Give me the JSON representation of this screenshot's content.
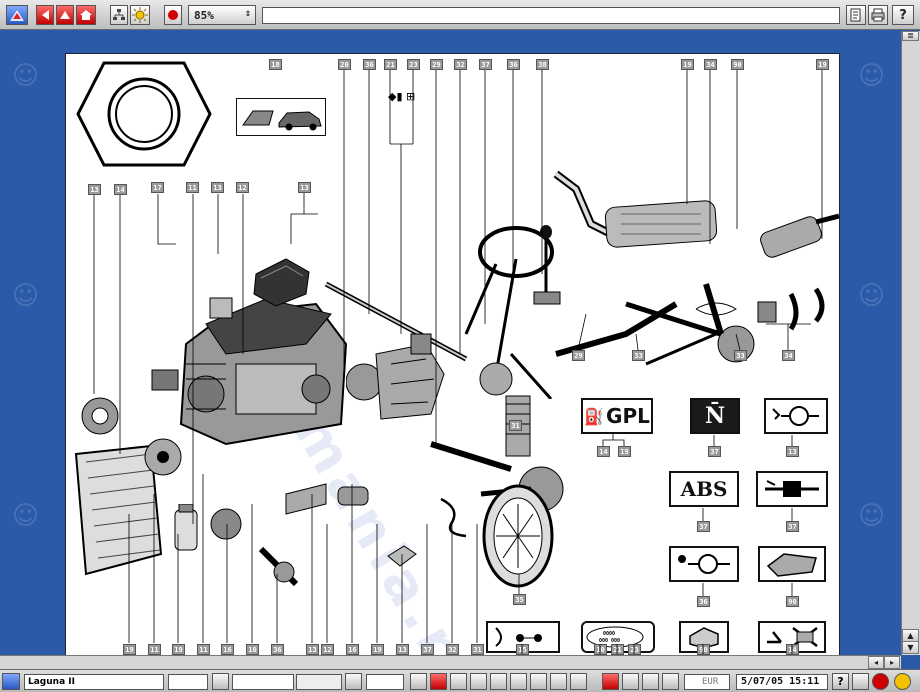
{
  "toolbar": {
    "zoom_value": "85%",
    "address_value": ""
  },
  "diagram": {
    "watermark_text": "ecmania.ru",
    "callouts_top": [
      "18",
      "20",
      "36",
      "21",
      "23",
      "29",
      "32",
      "37",
      "36",
      "38",
      "19",
      "34",
      "90",
      "19"
    ],
    "callouts_left": [
      "13",
      "14",
      "17",
      "11",
      "13",
      "12",
      "13"
    ],
    "callouts_bottom": [
      "19",
      "11",
      "19",
      "11",
      "16",
      "10",
      "36",
      "13",
      "12",
      "16",
      "19",
      "13",
      "37",
      "32",
      "31"
    ],
    "callouts_mid": [
      "29",
      "33",
      "33",
      "34",
      "31",
      "35",
      "15"
    ],
    "legend": {
      "gpl_text": "GPL",
      "gpl_refs": [
        "14",
        "19"
      ],
      "abs_text": "ABS",
      "refs": {
        "n_box": "37",
        "ctrl_box": "13",
        "abs_box": "37",
        "valve_box": "37",
        "brake_box": "36",
        "cable_box": "90",
        "ecu_box": "90",
        "tow_box": "14",
        "timing_box": [
          "10",
          "21",
          "23"
        ],
        "sensor_box": "15"
      }
    }
  },
  "status": {
    "document_title": "Laguna II",
    "currency_label": "EUR",
    "datetime": "5/07/05  15:11"
  }
}
